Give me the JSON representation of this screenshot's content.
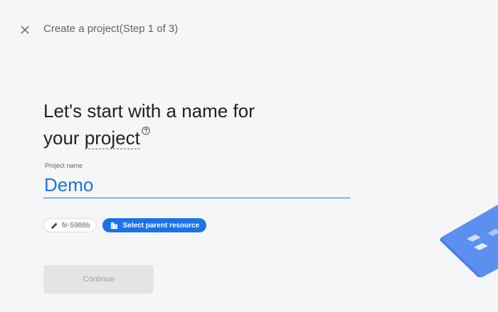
{
  "header": {
    "close_icon": "close-icon",
    "title": "Create a project(Step 1 of 3)"
  },
  "main": {
    "headline_line1": "Let's start with a name for",
    "headline_prefix": "your ",
    "headline_link": "project",
    "help_icon": "help-circle-icon",
    "project_name": {
      "label": "Project name",
      "value": "Demo"
    },
    "project_id_chip": {
      "icon": "pencil-icon",
      "label": "fir-5986b"
    },
    "parent_resource_chip": {
      "icon": "organization-icon",
      "label": "Select parent resource"
    },
    "continue_label": "Continue"
  },
  "colors": {
    "accent": "#1a73e8",
    "background": "#f5f6f8",
    "disabled_button": "#e4e5e7"
  }
}
